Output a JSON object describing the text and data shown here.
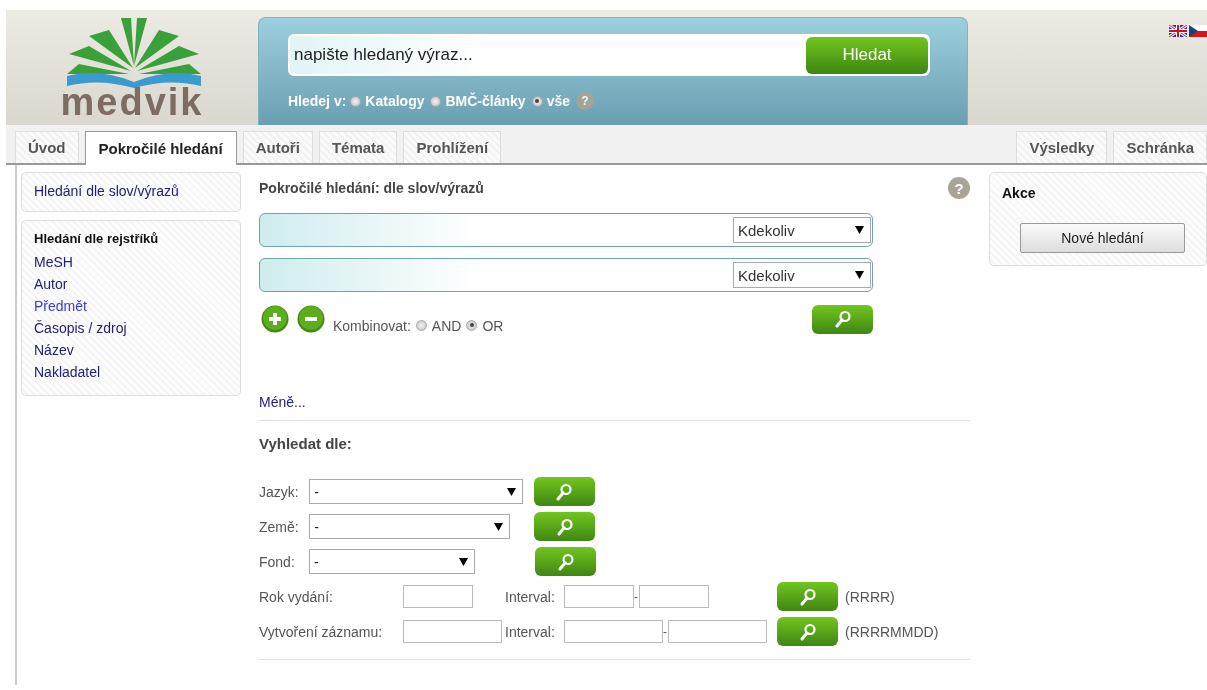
{
  "header": {
    "logo_text": "medvik",
    "search": {
      "placeholder": "napište hledaný výraz...",
      "button": "Hledat"
    },
    "scope": {
      "label": "Hledej v:",
      "options": [
        {
          "label": "Katalogy",
          "selected": false
        },
        {
          "label": "BMČ-články",
          "selected": false
        },
        {
          "label": "vše",
          "selected": true
        }
      ],
      "help": "?"
    },
    "languages": [
      {
        "kind": "en"
      },
      {
        "kind": "cs"
      }
    ]
  },
  "tabs": [
    {
      "label": "Úvod",
      "selected": false
    },
    {
      "label": "Pokročilé hledání",
      "selected": true
    },
    {
      "label": "Autoři",
      "selected": false
    },
    {
      "label": "Témata",
      "selected": false
    },
    {
      "label": "Prohlížení",
      "selected": false
    }
  ],
  "right_tabs": [
    {
      "label": "Výsledky",
      "selected": false
    },
    {
      "label": "Schránka",
      "selected": false
    }
  ],
  "sidebar": {
    "link": "Hledání dle slov/výrazů",
    "index_title": "Hledání dle rejstříků",
    "index_items": [
      {
        "label": "MeSH",
        "visited": false
      },
      {
        "label": "Autor",
        "visited": false
      },
      {
        "label": "Předmět",
        "visited": true
      },
      {
        "label": "Časopis / zdroj",
        "visited": false
      },
      {
        "label": "Název",
        "visited": false
      },
      {
        "label": "Nakladatel",
        "visited": false
      }
    ]
  },
  "main": {
    "title": "Pokročilé hledání: dle slov/výrazů",
    "help": "?",
    "queries": [
      {
        "field": "Kdekoliv"
      },
      {
        "field": "Kdekoliv"
      }
    ],
    "combine": {
      "label": "Kombinovat:",
      "options": [
        {
          "label": "AND",
          "selected": false
        },
        {
          "label": "OR",
          "selected": true
        }
      ]
    },
    "less_link": "Méně...",
    "filter_title": "Vyhledat dle:",
    "filters": [
      {
        "label": "Jazyk:",
        "value": "-"
      },
      {
        "label": "Země:",
        "value": "-"
      },
      {
        "label": "Fond:",
        "value": "-"
      }
    ],
    "ranges": [
      {
        "label": "Rok vydání:",
        "interval_label": "Interval:",
        "separator": "-",
        "format": "(RRRR)"
      },
      {
        "label": "Vytvoření záznamu:",
        "interval_label": "Interval:",
        "separator": "-",
        "format": "(RRRRMMDD)"
      }
    ]
  },
  "actions": {
    "title": "Akce",
    "button": "Nové hledání"
  }
}
